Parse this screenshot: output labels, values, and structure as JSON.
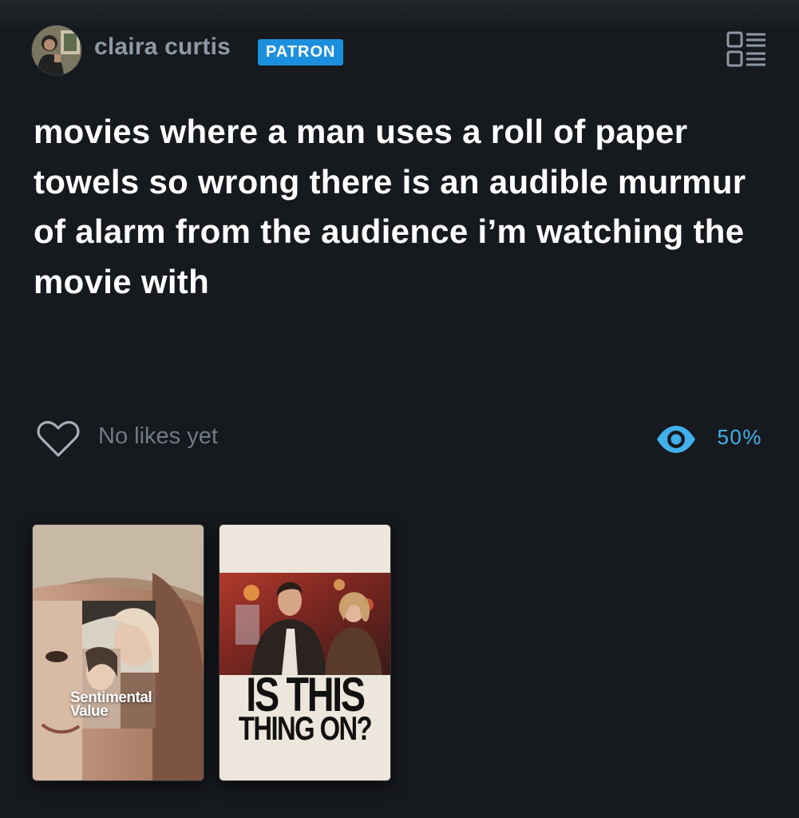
{
  "author": {
    "name": "claira curtis",
    "badge": "PATRON",
    "avatar": "user-avatar"
  },
  "menu": {
    "icon": "list-view-icon"
  },
  "post": {
    "text": "movies where a man uses a roll of paper towels so wrong there is an audible murmur of alarm from the audience i’m watching the movie with"
  },
  "stats": {
    "likes_text": "No likes yet",
    "like_icon": "heart-icon",
    "views_icon": "eye-icon",
    "views_percent": "50%"
  },
  "posters": [
    {
      "title": "Sentimental Value"
    },
    {
      "title_line1": "IS THIS",
      "title_line2": "THING ON?"
    }
  ],
  "colors": {
    "background": "#16191d",
    "accent": "#1c8fdd",
    "views": "#41b0ec",
    "username": "#8d98a5",
    "muted": "#6f7b87"
  }
}
